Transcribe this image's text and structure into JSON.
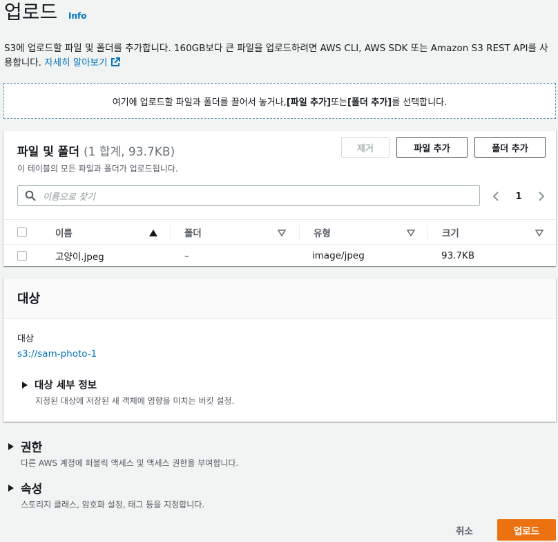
{
  "header": {
    "title": "업로드",
    "info_label": "Info",
    "description_text": "S3에 업로드할 파일 및 폴더를 추가합니다. 160GB보다 큰 파일을 업로드하려면 AWS CLI, AWS SDK 또는 Amazon S3 REST API를 사용합니다. ",
    "learn_more_label": "자세히 알아보기"
  },
  "dropzone": {
    "text_before": "여기에 업로드할 파일과 폴더를 끌어서 놓거나, ",
    "add_files_bracket": "[파일 추가]",
    "text_middle": " 또는 ",
    "add_folder_bracket": "[폴더 추가]",
    "text_after": "를 선택합니다."
  },
  "files_panel": {
    "title": "파일 및 폴더",
    "count": "(1 합계, 93.7KB)",
    "subtitle": "이 테이블의 모든 파일과 폴더가 업로드됩니다.",
    "remove_label": "제거",
    "add_files_label": "파일 추가",
    "add_folder_label": "폴더 추가",
    "search_placeholder": "이름으로 찾기",
    "page_number": "1",
    "columns": [
      "이름",
      "폴더",
      "유형",
      "크기"
    ],
    "rows": [
      {
        "name": "고양이.jpeg",
        "folder": "–",
        "type": "image/jpeg",
        "size": "93.7KB"
      }
    ]
  },
  "destination": {
    "title": "대상",
    "label": "대상",
    "path": "s3://sam-photo-1",
    "details_title": "대상 세부 정보",
    "details_desc": "지정된 대상에 저장된 새 객체에 영향을 미치는 버킷 설정."
  },
  "permissions": {
    "title": "권한",
    "desc": "다른 AWS 계정에 퍼블릭 액세스 및 액세스 권한을 부여합니다."
  },
  "properties": {
    "title": "속성",
    "desc": "스토리지 클래스, 암호화 설정, 태그 등을 지정합니다."
  },
  "footer": {
    "cancel_label": "취소",
    "upload_label": "업로드"
  },
  "colors": {
    "link": "#0073bb",
    "primary_button": "#ec7211",
    "background": "#f2f3f3"
  },
  "icons": [
    "external-link-icon",
    "search-icon",
    "chevron-left-icon",
    "chevron-right-icon",
    "sort-ascending-icon",
    "sort-caret-icon",
    "expand-caret-icon"
  ]
}
